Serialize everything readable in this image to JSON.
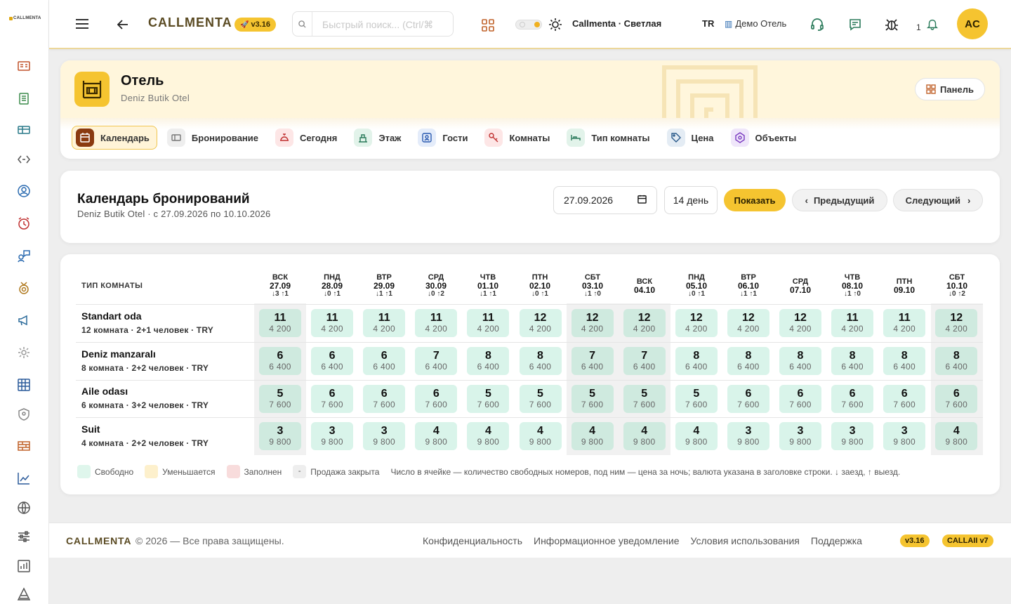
{
  "sidebar": {
    "logo": "CALLMENTA"
  },
  "topbar": {
    "brand": "CALLMENTA",
    "version": "v3.16",
    "search_placeholder": "Быстрый поиск... (Ctrl/⌘",
    "theme_label": "Callmenta · Светлая",
    "lang": "TR",
    "hotel": "Демо Отель",
    "notifications_count": "1",
    "avatar": "AC"
  },
  "header": {
    "title": "Отель",
    "subtitle": "Deniz Butik Otel",
    "panel_button": "Панель"
  },
  "tabs": [
    {
      "label": "Календарь",
      "icon": "calendar-icon",
      "active": true
    },
    {
      "label": "Бронирование",
      "icon": "booking-icon"
    },
    {
      "label": "Сегодня",
      "icon": "bell-service-icon"
    },
    {
      "label": "Этаж",
      "icon": "floor-icon"
    },
    {
      "label": "Гости",
      "icon": "guest-icon"
    },
    {
      "label": "Комнаты",
      "icon": "key-icon"
    },
    {
      "label": "Тип комнаты",
      "icon": "bed-icon"
    },
    {
      "label": "Цена",
      "icon": "tag-icon"
    },
    {
      "label": "Объекты",
      "icon": "object-icon"
    }
  ],
  "controls": {
    "title": "Календарь бронирований",
    "subtitle": "Deniz Butik Otel · с 27.09.2026 по 10.10.2026",
    "date": "27.09.2026",
    "days": "14 день",
    "show": "Показать",
    "prev": "Предыдущий",
    "next": "Следующий"
  },
  "calendar": {
    "col_header": "ТИП КОМНАТЫ",
    "days": [
      {
        "name": "ВСК",
        "date": "27.09",
        "arr": "↓3 ↑1",
        "weekend": true
      },
      {
        "name": "ПНД",
        "date": "28.09",
        "arr": "↓0 ↑1"
      },
      {
        "name": "ВТР",
        "date": "29.09",
        "arr": "↓1 ↑1"
      },
      {
        "name": "СРД",
        "date": "30.09",
        "arr": "↓0 ↑2"
      },
      {
        "name": "ЧТВ",
        "date": "01.10",
        "arr": "↓1 ↑1"
      },
      {
        "name": "ПТН",
        "date": "02.10",
        "arr": "↓0 ↑1"
      },
      {
        "name": "СБТ",
        "date": "03.10",
        "arr": "↓1 ↑0",
        "weekend": true
      },
      {
        "name": "ВСК",
        "date": "04.10",
        "arr": "",
        "weekend": true
      },
      {
        "name": "ПНД",
        "date": "05.10",
        "arr": "↓0 ↑1"
      },
      {
        "name": "ВТР",
        "date": "06.10",
        "arr": "↓1 ↑1"
      },
      {
        "name": "СРД",
        "date": "07.10",
        "arr": ""
      },
      {
        "name": "ЧТВ",
        "date": "08.10",
        "arr": "↓1 ↑0"
      },
      {
        "name": "ПТН",
        "date": "09.10",
        "arr": ""
      },
      {
        "name": "СБТ",
        "date": "10.10",
        "arr": "↓0 ↑2",
        "weekend": true
      }
    ],
    "rows": [
      {
        "title": "Standart oda",
        "sub": "12 комната · 2+1 человек · TRY",
        "price": "4 200",
        "avail": [
          "11",
          "11",
          "11",
          "11",
          "11",
          "12",
          "12",
          "12",
          "12",
          "12",
          "12",
          "11",
          "11",
          "12"
        ]
      },
      {
        "title": "Deniz manzaralı",
        "sub": "8 комната · 2+2 человек · TRY",
        "price": "6 400",
        "avail": [
          "6",
          "6",
          "6",
          "7",
          "8",
          "8",
          "7",
          "7",
          "8",
          "8",
          "8",
          "8",
          "8",
          "8"
        ]
      },
      {
        "title": "Aile odası",
        "sub": "6 комната · 3+2 человек · TRY",
        "price": "7 600",
        "avail": [
          "5",
          "6",
          "6",
          "6",
          "5",
          "5",
          "5",
          "5",
          "5",
          "6",
          "6",
          "6",
          "6",
          "6"
        ]
      },
      {
        "title": "Suit",
        "sub": "4 комната · 2+2 человек · TRY",
        "price": "9 800",
        "avail": [
          "3",
          "3",
          "3",
          "4",
          "4",
          "4",
          "4",
          "4",
          "4",
          "3",
          "3",
          "3",
          "3",
          "4"
        ]
      }
    ]
  },
  "legend": {
    "free": "Свободно",
    "decreasing": "Уменьшается",
    "full": "Заполнен",
    "closed_mark": "-",
    "closed": "Продажа закрыта",
    "note": "Число в ячейке — количество свободных номеров, под ним — цена за ночь; валюта указана в заголовке строки. ↓ заезд, ↑ выезд."
  },
  "footer": {
    "brand": "CALLMENTA",
    "copy": "© 2026 — Все права защищены.",
    "links": [
      "Конфиденциальность",
      "Информационное уведомление",
      "Условия использования",
      "Поддержка"
    ],
    "badge1": "v3.16",
    "badge2": "CALLAII v7"
  },
  "colors": {
    "accent": "#f5c430",
    "free": "#d9f4ea",
    "brand": "#5a4a22"
  }
}
